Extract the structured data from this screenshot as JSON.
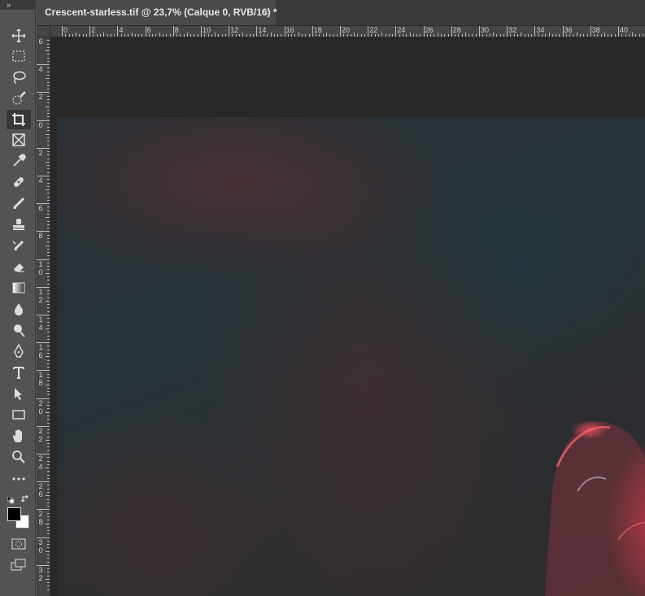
{
  "document_tab": {
    "title": "Crescent-starless.tif @ 23,7% (Calque 0, RVB/16) *",
    "close_glyph": "×"
  },
  "toolbar": {
    "collapse_glyph": "››",
    "tools": [
      {
        "name": "move-tool",
        "icon": "move-icon"
      },
      {
        "name": "marquee-tool",
        "icon": "rect-marquee-icon"
      },
      {
        "name": "lasso-tool",
        "icon": "lasso-icon"
      },
      {
        "name": "quick-selection-tool",
        "icon": "quick-selection-icon"
      },
      {
        "name": "crop-tool",
        "icon": "crop-icon",
        "active": true
      },
      {
        "name": "frame-tool",
        "icon": "frame-icon"
      },
      {
        "name": "eyedropper-tool",
        "icon": "eyedropper-icon"
      },
      {
        "name": "healing-brush-tool",
        "icon": "bandage-icon"
      },
      {
        "name": "brush-tool",
        "icon": "brush-icon"
      },
      {
        "name": "clone-stamp-tool",
        "icon": "stamp-icon"
      },
      {
        "name": "history-brush-tool",
        "icon": "history-brush-icon"
      },
      {
        "name": "eraser-tool",
        "icon": "eraser-icon"
      },
      {
        "name": "gradient-tool",
        "icon": "gradient-icon"
      },
      {
        "name": "blur-tool",
        "icon": "drop-icon"
      },
      {
        "name": "dodge-tool",
        "icon": "dodge-icon"
      },
      {
        "name": "pen-tool",
        "icon": "pen-icon"
      },
      {
        "name": "type-tool",
        "icon": "type-icon"
      },
      {
        "name": "path-selection-tool",
        "icon": "arrow-icon"
      },
      {
        "name": "rectangle-tool",
        "icon": "rectangle-icon"
      },
      {
        "name": "hand-tool",
        "icon": "hand-icon"
      },
      {
        "name": "zoom-tool",
        "icon": "zoom-icon"
      },
      {
        "name": "edit-toolbar",
        "icon": "more-icon"
      }
    ],
    "foreground_color": "#000000",
    "background_color": "#ffffff"
  },
  "ruler_h_labels": [
    "0",
    "2",
    "4",
    "6",
    "8",
    "10",
    "12",
    "14",
    "16",
    "18",
    "20",
    "22",
    "24",
    "26",
    "28",
    "30",
    "32",
    "34",
    "36",
    "38",
    "40"
  ],
  "ruler_v_labels": [
    [
      "6"
    ],
    [
      "4"
    ],
    [
      "2"
    ],
    [
      "0"
    ],
    [
      "2"
    ],
    [
      "4"
    ],
    [
      "6"
    ],
    [
      "8"
    ],
    [
      "1",
      "0"
    ],
    [
      "1",
      "2"
    ],
    [
      "1",
      "4"
    ],
    [
      "1",
      "6"
    ],
    [
      "1",
      "8"
    ],
    [
      "2",
      "0"
    ],
    [
      "2",
      "2"
    ],
    [
      "2",
      "4"
    ],
    [
      "2",
      "6"
    ],
    [
      "2",
      "8"
    ],
    [
      "3",
      "0"
    ],
    [
      "3",
      "2"
    ]
  ]
}
